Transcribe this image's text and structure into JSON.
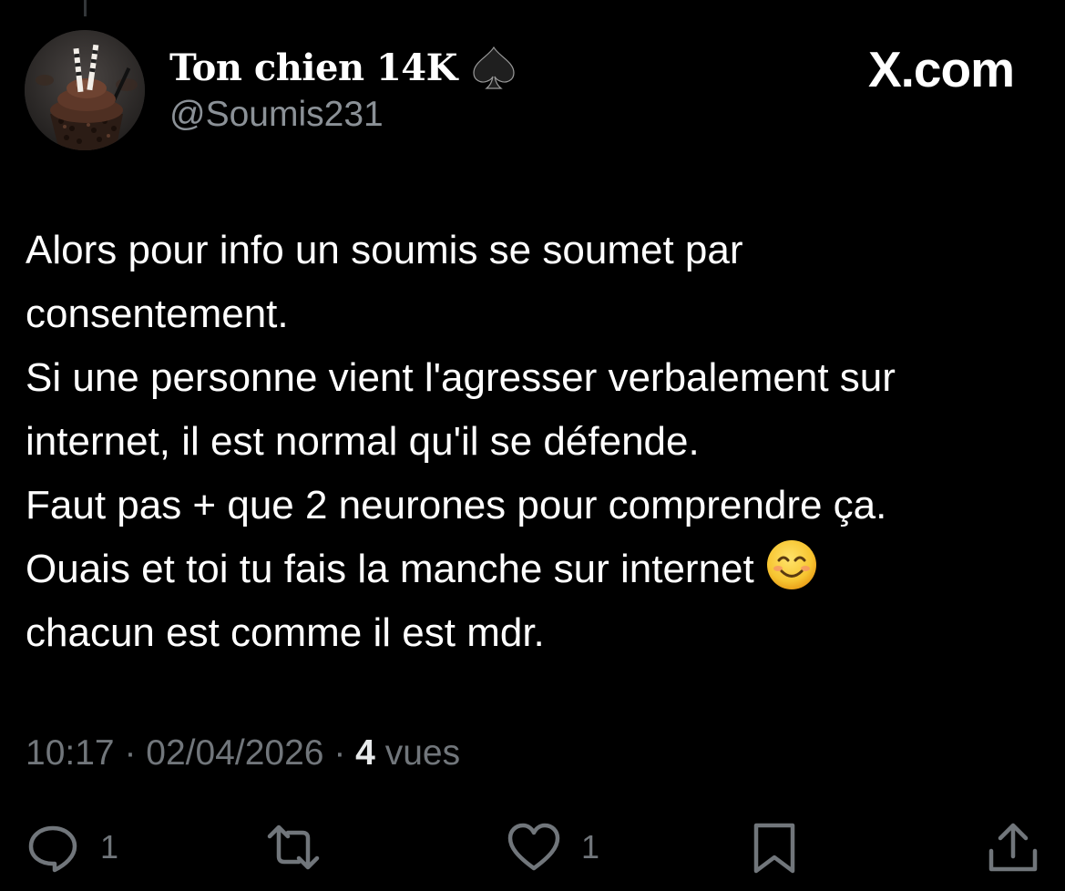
{
  "user": {
    "display_name": "Ton chien 14K",
    "badge_icon": "spade-icon",
    "handle": "@Soumis231",
    "avatar_icon": "cupcake-avatar"
  },
  "brand": {
    "label": "X.com"
  },
  "tweet": {
    "lines": [
      "Alors pour info un soumis se soumet par",
      "consentement.",
      "Si une personne vient l'agresser verbalement sur",
      "internet, il est normal qu'il se défende.",
      "Faut pas + que 2 neurones pour comprendre ça.",
      "Ouais et toi tu fais la manche sur internet",
      "chacun est comme il est mdr."
    ],
    "emoji_icon": "smiling-face-icon"
  },
  "meta": {
    "time": "10:17",
    "separator": " · ",
    "date": "02/04/2026",
    "views_count": "4",
    "views_label": " vues"
  },
  "actions": {
    "reply_count": "1",
    "like_count": "1",
    "reply_icon": "reply-icon",
    "retweet_icon": "retweet-icon",
    "like_icon": "heart-icon",
    "bookmark_icon": "bookmark-icon",
    "share_icon": "share-icon"
  },
  "colors": {
    "background": "#000000",
    "text_primary": "#ffffff",
    "text_secondary": "#71767b"
  }
}
